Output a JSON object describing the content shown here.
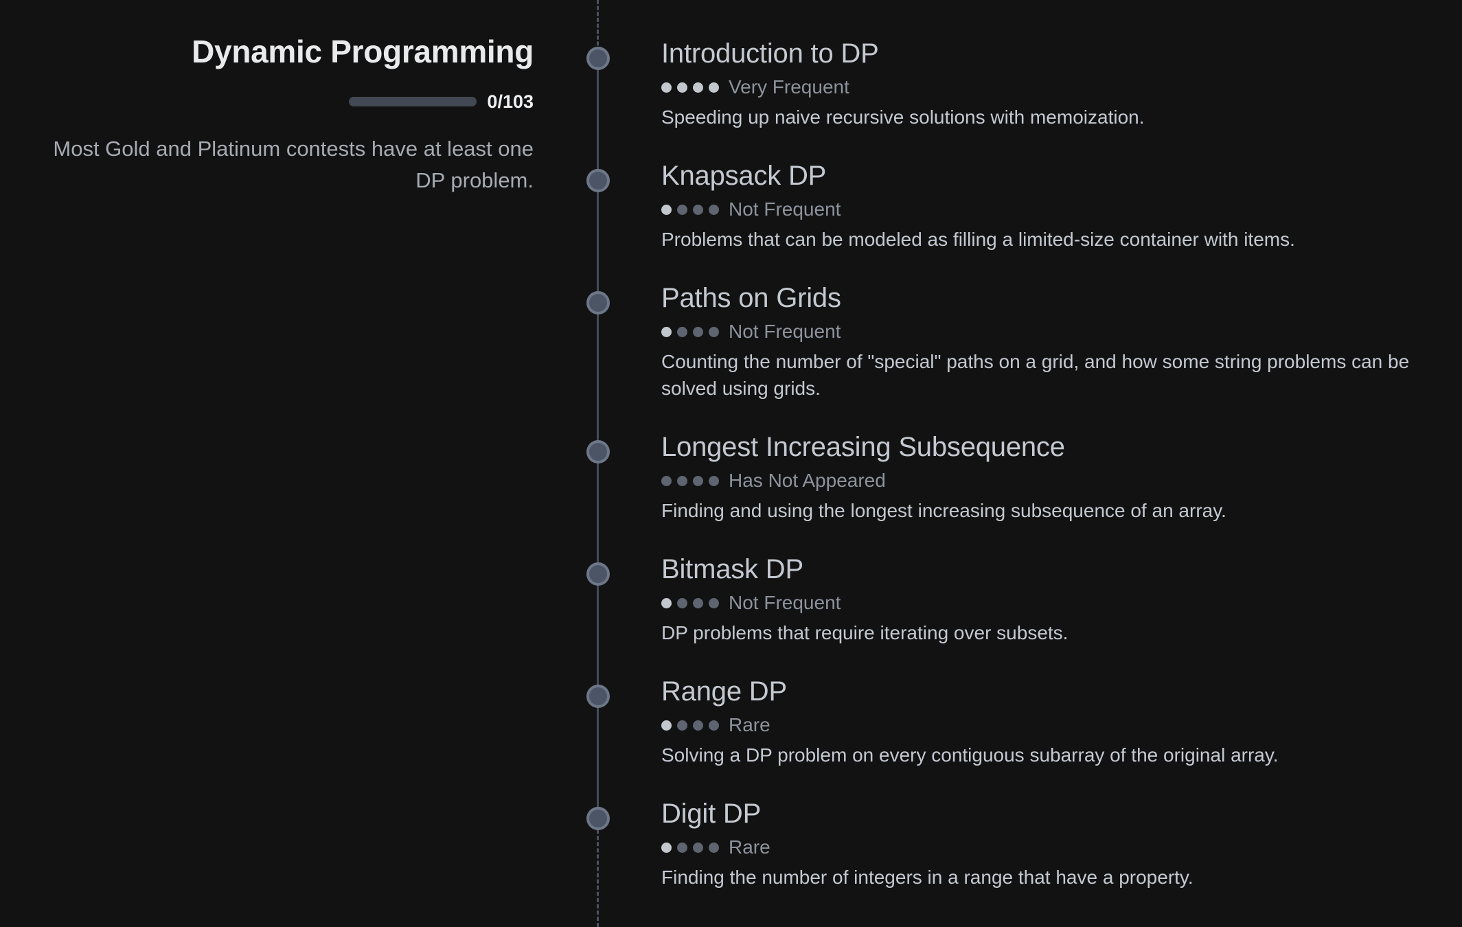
{
  "section": {
    "title": "Dynamic Programming",
    "progress": {
      "count_label": "0/103",
      "completed": 0,
      "total": 103
    },
    "description": "Most Gold and Platinum contests have at least one DP problem."
  },
  "colors": {
    "background": "#121213",
    "progress_track": "#424954",
    "node": "#4c5566",
    "dot_filled": "#c3c7ce",
    "dot_empty": "#5e6571"
  },
  "modules": [
    {
      "title": "Introduction to DP",
      "frequency": "Very Frequent",
      "frequency_level": 4,
      "description": "Speeding up naive recursive solutions with memoization."
    },
    {
      "title": "Knapsack DP",
      "frequency": "Not Frequent",
      "frequency_level": 1,
      "description": "Problems that can be modeled as filling a limited-size container with items."
    },
    {
      "title": "Paths on Grids",
      "frequency": "Not Frequent",
      "frequency_level": 1,
      "description": "Counting the number of \"special\" paths on a grid, and how some string problems can be solved using grids."
    },
    {
      "title": "Longest Increasing Subsequence",
      "frequency": "Has Not Appeared",
      "frequency_level": 0,
      "description": "Finding and using the longest increasing subsequence of an array."
    },
    {
      "title": "Bitmask DP",
      "frequency": "Not Frequent",
      "frequency_level": 1,
      "description": "DP problems that require iterating over subsets."
    },
    {
      "title": "Range DP",
      "frequency": "Rare",
      "frequency_level": 1,
      "description": "Solving a DP problem on every contiguous subarray of the original array."
    },
    {
      "title": "Digit DP",
      "frequency": "Rare",
      "frequency_level": 1,
      "description": "Finding the number of integers in a range that have a property."
    }
  ]
}
